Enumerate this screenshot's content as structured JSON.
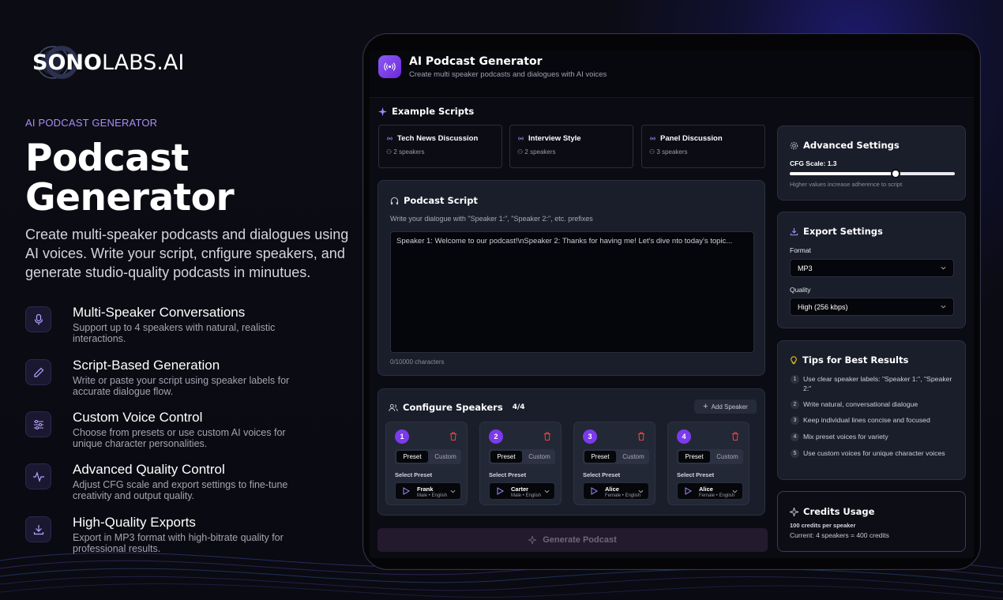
{
  "brand": {
    "logo_bold": "SONO",
    "logo_rest": "LABS.AI"
  },
  "hero": {
    "eyebrow": "AI PODCAST GENERATOR",
    "title_line1": "Podcast",
    "title_line2": "Generator",
    "description": "Create multi-speaker podcasts and dialogues using AI voices. Write your script, cnfigure speakers, and generate studio-quality podcasts in minutues."
  },
  "features": [
    {
      "icon": "microphone-icon",
      "title": "Multi-Speaker Conversations",
      "desc": "Support up to 4 speakers with natural, realistic interactions."
    },
    {
      "icon": "pencil-icon",
      "title": "Script-Based Generation",
      "desc": "Write or paste your script using speaker labels for accurate dialogue flow."
    },
    {
      "icon": "sliders-icon",
      "title": "Custom Voice Control",
      "desc": "Choose from presets or use custom AI voices for unique character personalities."
    },
    {
      "icon": "waveform-icon",
      "title": "Advanced Quality Control",
      "desc": "Adjust CFG scale and export settings to fine-tune creativity and output quality."
    },
    {
      "icon": "download-icon",
      "title": "High-Quality Exports",
      "desc": "Export in MP3 format with high-bitrate quality for professional results."
    }
  ],
  "app": {
    "title": "AI Podcast Generator",
    "subtitle": "Create multi  speaker podcasts and dialogues with AI voices",
    "examples_title": "Example Scripts",
    "examples": [
      {
        "name": "Tech News Discussion",
        "speakers": "2 speakers"
      },
      {
        "name": "Interview Style",
        "speakers": "2 speakers"
      },
      {
        "name": "Panel Discussion",
        "speakers": "3 speakers"
      }
    ],
    "script": {
      "title": "Podcast Script",
      "hint": "Write your dialogue with \"Speaker 1:\", \"Speaker 2:\", etc. prefixes",
      "placeholder": "Speaker 1: Welcome to our podcast!\\nSpeaker 2: Thanks for having me! Let's dive nto today's topic...",
      "count": "0/10000 characters"
    },
    "speakers": {
      "title": "Configure Speakers",
      "count": "4/4",
      "add_label": "Add Speaker",
      "preset_tab": "Preset",
      "custom_tab": "Custom",
      "select_label": "Select Preset",
      "items": [
        {
          "num": "1",
          "voice": "Frank",
          "meta": "Male • English"
        },
        {
          "num": "2",
          "voice": "Carter",
          "meta": "Male • English"
        },
        {
          "num": "3",
          "voice": "Alice",
          "meta": "Female • English"
        },
        {
          "num": "4",
          "voice": "Alice",
          "meta": "Female • English"
        }
      ]
    },
    "generate_label": "Generate Podcast",
    "advanced": {
      "title": "Advanced Settings",
      "cfg_label": "CFG Scale: 1.3",
      "cfg_value": 1.3,
      "cfg_fill": 0.64,
      "cfg_hint": "Higher values increase adherence to script"
    },
    "export": {
      "title": "Export Settings",
      "format_label": "Format",
      "format_value": "MP3",
      "quality_label": "Quality",
      "quality_value": "High (256 kbps)"
    },
    "tips": {
      "title": "Tips for Best Results",
      "items": [
        {
          "n": "1",
          "text": "Use clear speaker labels: \"Speaker 1:\", \"Speaker 2:\""
        },
        {
          "n": "2",
          "text": "Write natural, conversational dialogue"
        },
        {
          "n": "3",
          "text": "Keep individual lines concise and focused"
        },
        {
          "n": "4",
          "text": "Mix preset voices for variety"
        },
        {
          "n": "5",
          "text": "Use custom voices for unique character voices"
        }
      ]
    },
    "credits": {
      "title": "Credits Usage",
      "per": "100 credits per speaker",
      "current": "Current: 4 speakers = 400 credits"
    }
  },
  "colors": {
    "accent": "#7c3aed",
    "eyebrow": "#a98ef5",
    "danger": "#ef4444"
  }
}
